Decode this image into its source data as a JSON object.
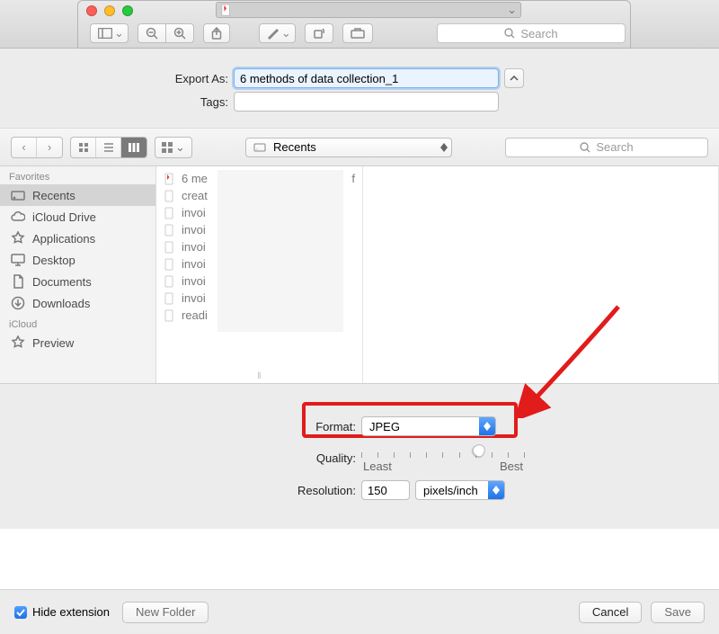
{
  "window": {
    "search_placeholder": "Search"
  },
  "export": {
    "export_as_label": "Export As:",
    "filename": "6 methods of data collection_1",
    "tags_label": "Tags:",
    "tags_value": ""
  },
  "browser": {
    "location_label": "Recents",
    "search_placeholder": "Search",
    "sidebar": {
      "favorites_header": "Favorites",
      "icloud_header": "iCloud",
      "items": [
        {
          "label": "Recents"
        },
        {
          "label": "iCloud Drive"
        },
        {
          "label": "Applications"
        },
        {
          "label": "Desktop"
        },
        {
          "label": "Documents"
        },
        {
          "label": "Downloads"
        }
      ],
      "icloud_items": [
        {
          "label": "Preview"
        }
      ]
    },
    "files": [
      {
        "name": "6 me",
        "suffix": "f",
        "pdf": true
      },
      {
        "name": "creat"
      },
      {
        "name": "invoi"
      },
      {
        "name": "invoi"
      },
      {
        "name": "invoi"
      },
      {
        "name": "invoi"
      },
      {
        "name": "invoi"
      },
      {
        "name": "invoi"
      },
      {
        "name": "readi"
      }
    ]
  },
  "options": {
    "format_label": "Format:",
    "format_value": "JPEG",
    "quality_label": "Quality:",
    "quality_least": "Least",
    "quality_best": "Best",
    "resolution_label": "Resolution:",
    "resolution_value": "150",
    "resolution_unit": "pixels/inch"
  },
  "footer": {
    "hide_ext_label": "Hide extension",
    "new_folder": "New Folder",
    "cancel": "Cancel",
    "save": "Save"
  }
}
